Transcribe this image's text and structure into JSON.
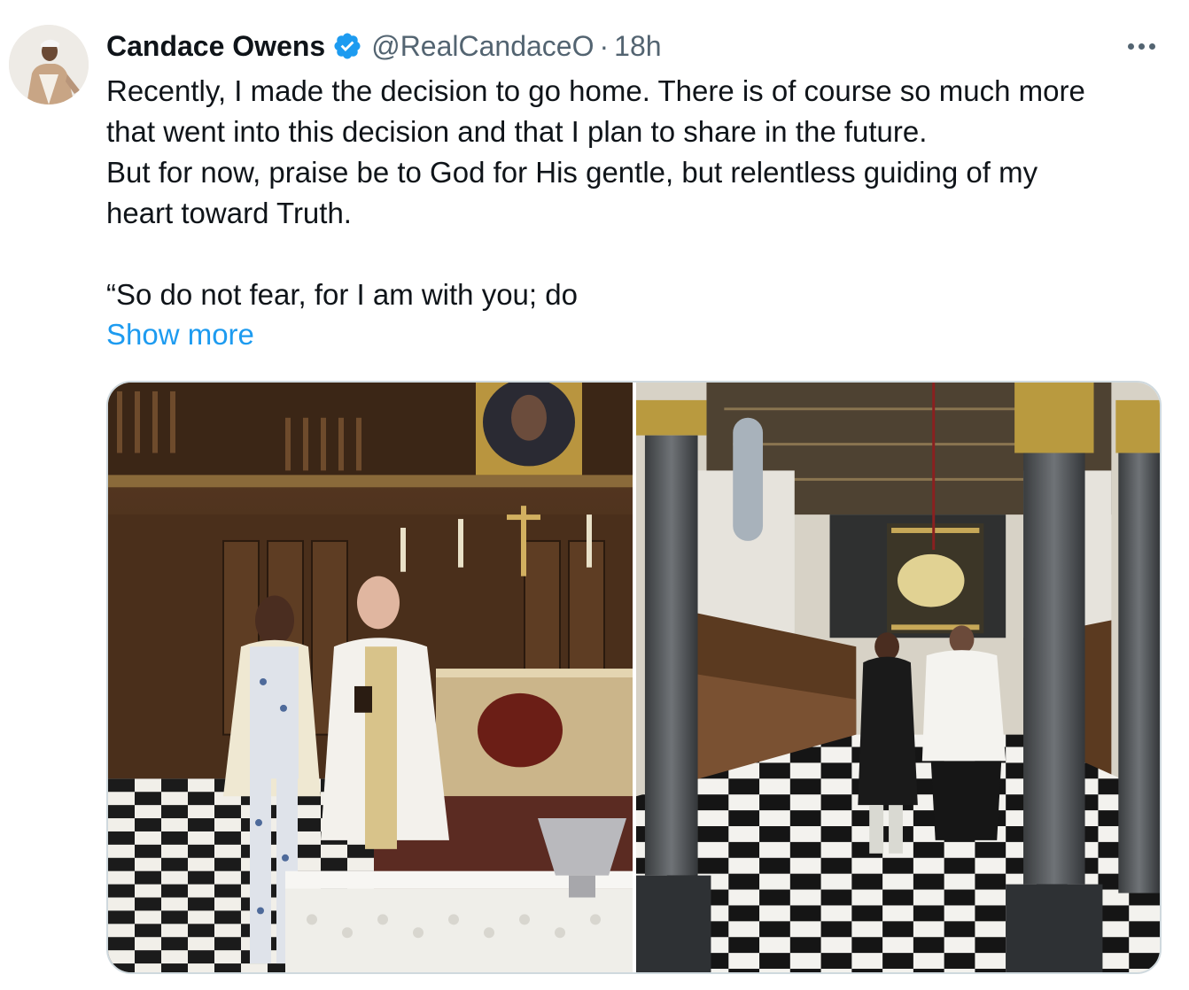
{
  "author": {
    "display_name": "Candace Owens",
    "handle": "@RealCandaceO",
    "separator": "·",
    "time": "18h",
    "verified_icon": "verified-badge-icon",
    "avatar_icon": "profile-avatar"
  },
  "tweet": {
    "lines": [
      "Recently, I made the decision to go home. There is of course so much more",
      "that went into this decision and that I plan to share in the future.",
      "But for now, praise be to God for His gentle, but relentless guiding of my",
      "heart toward Truth."
    ],
    "quote_line": "“So do not fear, for I am with you; do",
    "show_more": "Show more"
  },
  "media": [
    {
      "icon": "altar-photo",
      "kind": "photo"
    },
    {
      "icon": "chapel-aisle-photo",
      "kind": "photo"
    }
  ],
  "colors": {
    "text": "#0f1419",
    "secondary": "#536471",
    "link": "#1d9bf0",
    "border": "#cfd9de"
  },
  "more_icon": "more-options-icon"
}
